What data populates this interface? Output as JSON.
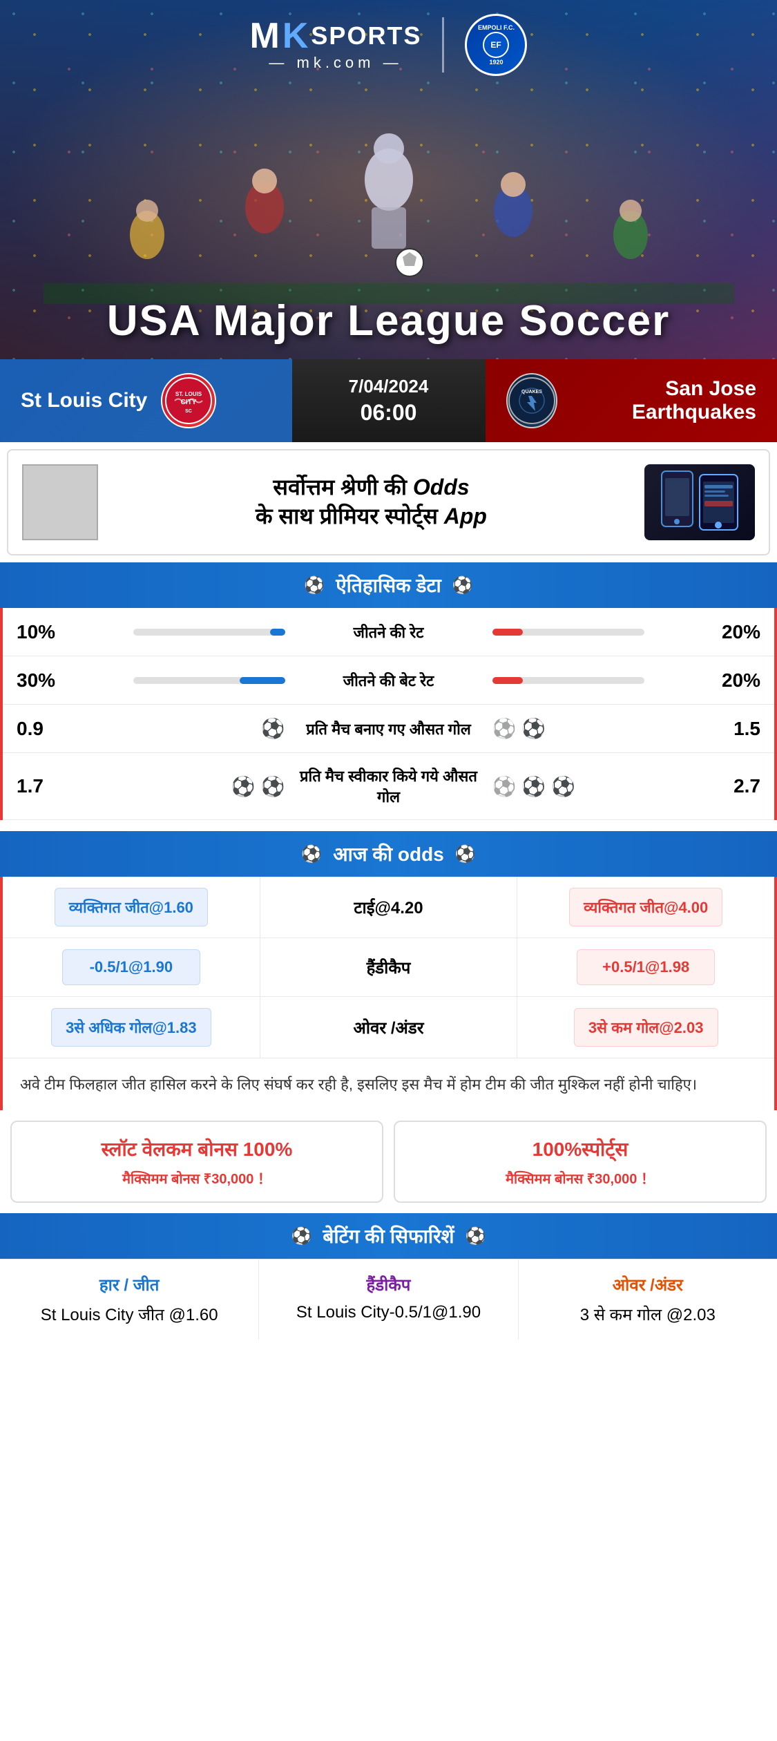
{
  "brand": {
    "mk_m": "M",
    "mk_k": "K",
    "sports": "SPORTS",
    "url": "— mk.com —",
    "empoli_line1": "EMPOLI F.C.",
    "empoli_year": "1920"
  },
  "banner": {
    "title": "USA Major League Soccer"
  },
  "match": {
    "home_team": "St Louis City",
    "away_team": "San Jose Earthquakes",
    "date": "7/04/2024",
    "time": "06:00",
    "quakes_label": "QUAKES"
  },
  "promo": {
    "text": "सर्वोत्तम श्रेणी की Odds\nके साथ प्रीमियर स्पोर्ट्स App"
  },
  "historical": {
    "section_title": "ऐतिहासिक डेटा",
    "rows": [
      {
        "label": "जीतने की रेट",
        "left_val": "10%",
        "right_val": "20%",
        "left_pct": 10,
        "right_pct": 20
      },
      {
        "label": "जीतने की बेट रेट",
        "left_val": "30%",
        "right_val": "20%",
        "left_pct": 30,
        "right_pct": 20
      },
      {
        "label": "प्रति मैच बनाए गए औसत गोल",
        "left_val": "0.9",
        "right_val": "1.5",
        "left_balls": 1,
        "right_balls": 2
      },
      {
        "label": "प्रति मैच स्वीकार किये गये औसत गोल",
        "left_val": "1.7",
        "right_val": "2.7",
        "left_balls": 2,
        "right_balls": 3
      }
    ]
  },
  "odds": {
    "section_title": "आज की odds",
    "rows": [
      {
        "left": "व्यक्तिगत जीत@1.60",
        "center": "टाई@4.20",
        "right": "व्यक्तिगत जीत@4.00"
      },
      {
        "left": "-0.5/1@1.90",
        "center": "हैंडीकैप",
        "right": "+0.5/1@1.98"
      },
      {
        "left": "3से अधिक गोल@1.83",
        "center": "ओवर /अंडर",
        "right": "3से कम गोल@2.03"
      }
    ]
  },
  "analysis": {
    "text": "अवे टीम फिलहाल जीत हासिल करने के लिए संघर्ष कर रही है, इसलिए इस मैच में होम टीम की जीत मुश्किल नहीं होनी चाहिए।"
  },
  "bonus": {
    "left_title": "स्लॉट वेलकम बोनस",
    "left_percent": "100%",
    "left_sub": "मैक्सिमम बोनस ₹30,000  ！",
    "right_title": "100%स्पोर्ट्स",
    "right_sub": "मैक्सिमम बोनस  ₹30,000 ！"
  },
  "betting_reco": {
    "section_title": "बेटिंग की सिफारिशें",
    "col1_label": "हार / जीत",
    "col1_value": "St Louis City जीत @1.60",
    "col2_label": "हैंडीकैप",
    "col2_value": "St Louis City-0.5/1@1.90",
    "col3_label": "ओवर /अंडर",
    "col3_value": "3 से कम गोल @2.03"
  }
}
